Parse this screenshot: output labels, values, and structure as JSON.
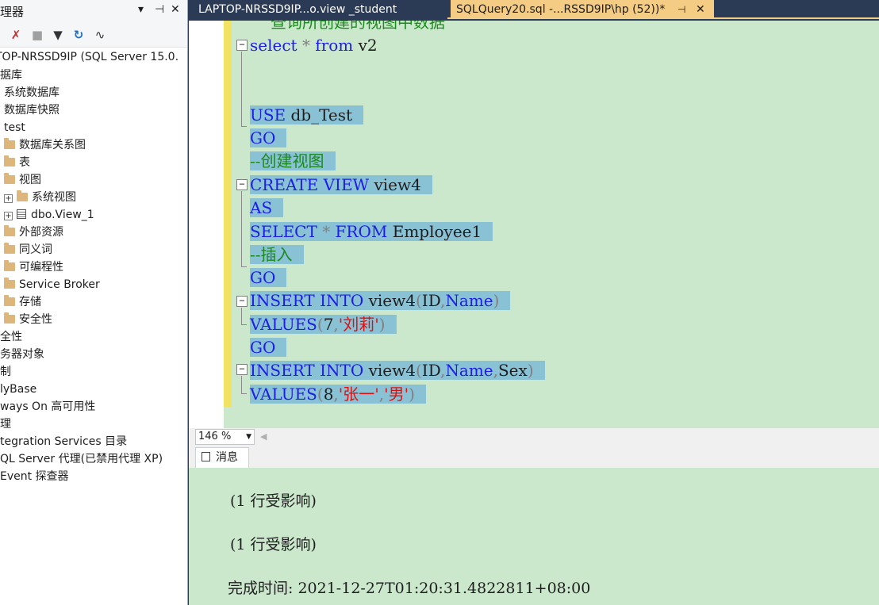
{
  "explorer": {
    "title": "理器",
    "server": "TOP-NRSSD9IP (SQL Server 15.0.",
    "tree": [
      {
        "label": "据库"
      },
      {
        "label": "系统数据库"
      },
      {
        "label": "数据库快照"
      },
      {
        "label": "test"
      },
      {
        "label": "数据库关系图"
      },
      {
        "label": "表"
      },
      {
        "label": "视图"
      },
      {
        "label": "系统视图"
      },
      {
        "label": "dbo.View_1"
      },
      {
        "label": "外部资源"
      },
      {
        "label": "同义词"
      },
      {
        "label": "可编程性"
      },
      {
        "label": "Service Broker"
      },
      {
        "label": "存储"
      },
      {
        "label": "安全性"
      },
      {
        "label": "全性"
      },
      {
        "label": "务器对象"
      },
      {
        "label": "制"
      },
      {
        "label": "lyBase"
      },
      {
        "label": "ways On 高可用性"
      },
      {
        "label": "理"
      },
      {
        "label": "tegration Services 目录"
      },
      {
        "label": "QL Server 代理(已禁用代理 XP)"
      },
      {
        "label": "Event 探查器"
      }
    ]
  },
  "tabs": {
    "tab1": "LAPTOP-NRSSD9IP...o.view _student",
    "tab2": "SQLQuery20.sql -...RSSD9IP\\hp (52))*",
    "pin_glyph": "⊣",
    "close_glyph": "✕"
  },
  "editor": {
    "partial_top_comment": "查询所创建的视图中数据",
    "l1_kw1": "select",
    "l1_op": "*",
    "l1_kw2": "from",
    "l1_id": "v2",
    "l2_kw": "USE",
    "l2_id": "db_Test",
    "l3_kw": "GO",
    "l4_cm": "--创建视图",
    "l5_kw1": "CREATE",
    "l5_kw2": "VIEW",
    "l5_id": "view4",
    "l6_kw": "AS",
    "l7_kw1": "SELECT",
    "l7_op": "*",
    "l7_kw2": "FROM",
    "l7_id": "Employee1",
    "l8_cm": "--插入",
    "l9_kw": "GO",
    "l10_kw1": "INSERT",
    "l10_kw2": "INTO",
    "l10_id": "view4",
    "l10_p1": "(",
    "l10_c1": "ID",
    "l10_comma": ",",
    "l10_c2": "Name",
    "l10_p2": ")",
    "l11_kw": "VALUES",
    "l11_p1": "(",
    "l11_num": "7",
    "l11_comma": ",",
    "l11_str": "'刘莉'",
    "l11_p2": ")",
    "l12_kw": "GO",
    "l13_kw1": "INSERT",
    "l13_kw2": "INTO",
    "l13_id": "view4",
    "l13_p1": "(",
    "l13_c1": "ID",
    "l13_comma1": ",",
    "l13_c2": "Name",
    "l13_comma2": ",",
    "l13_c3": "Sex",
    "l13_p2": ")",
    "l14_kw": "VALUES",
    "l14_p1": "(",
    "l14_num": "8",
    "l14_comma1": ",",
    "l14_str1": "'张一'",
    "l14_comma2": ",",
    "l14_str2": "'男'",
    "l14_p2": ")"
  },
  "zoom": {
    "value": "146 %"
  },
  "results": {
    "tab_label": "消息",
    "msg1": "(1 行受影响)",
    "msg2": "(1 行受影响)",
    "completion_label": "完成时间:",
    "completion_value": "2021-12-27T01:20:31.4822811+08:00"
  },
  "colors": {
    "editor_bg": "#cbe8cd",
    "selection": "#89c1d5",
    "keyword": "#1d1de4",
    "string": "#e01010",
    "comment": "#1c8a1c",
    "active_tab": "#f5cc84",
    "chrome": "#2b3a55"
  }
}
